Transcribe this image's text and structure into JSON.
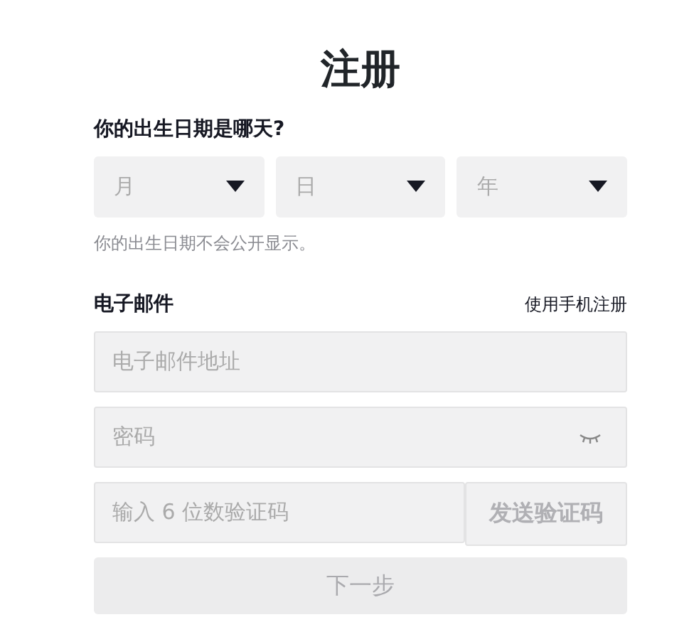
{
  "title": "注册",
  "birthday": {
    "label": "你的出生日期是哪天?",
    "selects": [
      {
        "placeholder": "月"
      },
      {
        "placeholder": "日"
      },
      {
        "placeholder": "年"
      }
    ],
    "hint": "你的出生日期不会公开显示。"
  },
  "email": {
    "label": "电子邮件",
    "switch_link": "使用手机注册",
    "email_field": {
      "placeholder": "电子邮件地址"
    },
    "password_field": {
      "placeholder": "密码"
    },
    "code_field": {
      "placeholder": "输入 6 位数验证码"
    },
    "send_code_button": {
      "label": "发送验证码",
      "disabled": true
    }
  },
  "next_button": {
    "label": "下一步",
    "disabled": true
  }
}
